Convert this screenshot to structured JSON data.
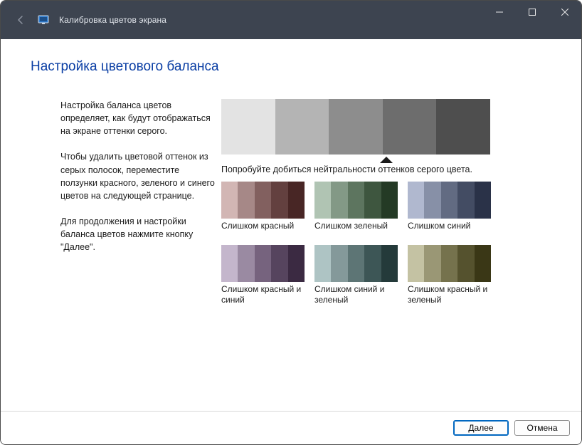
{
  "titlebar": {
    "caption": "Калибровка цветов экрана"
  },
  "heading": "Настройка цветового баланса",
  "paragraphs": {
    "p1": "Настройка баланса цветов определяет, как будут отображаться на экране оттенки серого.",
    "p2": "Чтобы удалить цветовой оттенок из серых полосок, переместите ползунки красного, зеленого и синего цветов на следующей странице.",
    "p3": "Для продолжения и настройки баланса цветов нажмите кнопку \"Далее\"."
  },
  "neutral_line": "Попробуйте добиться нейтральности оттенков серого цвета.",
  "big_bar_colors": [
    "#e3e3e3",
    "#b4b4b4",
    "#8d8d8d",
    "#6d6d6d",
    "#4e4e4e"
  ],
  "samples": [
    {
      "label": "Слишком красный",
      "colors": [
        "#d2b6b4",
        "#a68887",
        "#82605f",
        "#63403f",
        "#482625"
      ]
    },
    {
      "label": "Слишком зеленый",
      "colors": [
        "#b0c4b3",
        "#839986",
        "#5d755f",
        "#3e563f",
        "#243a25"
      ]
    },
    {
      "label": "Слишком синий",
      "colors": [
        "#b0b8cf",
        "#8790a7",
        "#626b82",
        "#434c63",
        "#2a3248"
      ]
    },
    {
      "label": "Слишком красный и синий",
      "colors": [
        "#c4b6cc",
        "#9a8aa2",
        "#76637e",
        "#56445e",
        "#3b2a42"
      ]
    },
    {
      "label": "Слишком синий и зеленый",
      "colors": [
        "#aec4c4",
        "#84999a",
        "#5d7575",
        "#3d5656",
        "#243a3a"
      ]
    },
    {
      "label": "Слишком красный и зеленый",
      "colors": [
        "#c4c2a3",
        "#9a9775",
        "#75724d",
        "#55522e",
        "#3a3716"
      ]
    }
  ],
  "footer": {
    "next": "Далее",
    "cancel": "Отмена"
  }
}
